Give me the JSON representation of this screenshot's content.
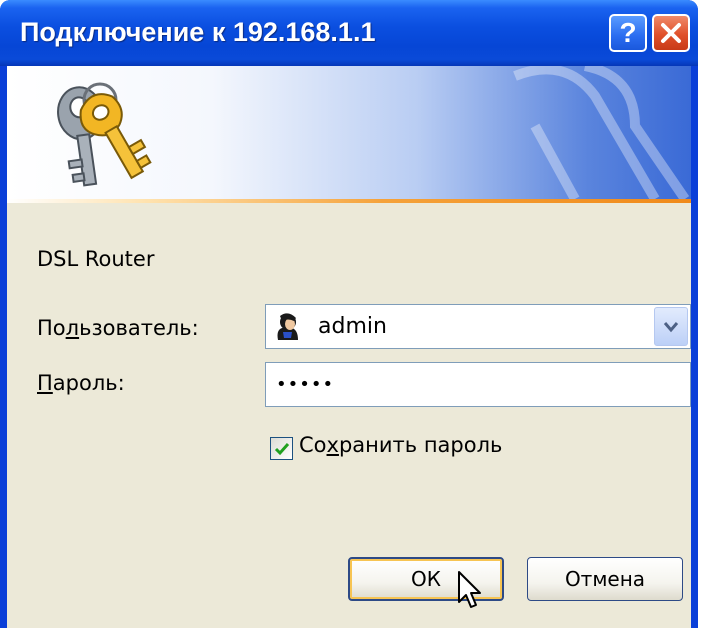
{
  "window": {
    "title": "Подключение к 192.168.1.1",
    "help_button": "?",
    "close_button": "✕"
  },
  "icons": {
    "banner": "keys-icon",
    "user": "user-icon",
    "dropdown": "chevron-down-icon",
    "checkbox": "checkmark-icon",
    "cursor": "mouse-pointer-icon"
  },
  "dialog": {
    "realm": "DSL Router",
    "username_label_prefix": "По",
    "username_label_underlined": "л",
    "username_label_suffix": "ьзователь:",
    "username_value": "admin",
    "password_label_underlined": "П",
    "password_label_suffix": "ароль:",
    "password_value": "•••••",
    "remember_label_prefix": "Со",
    "remember_label_underlined": "х",
    "remember_label_suffix": "ранить пароль",
    "remember_checked": true,
    "ok_label": "ОК",
    "cancel_label": "Отмена"
  },
  "colors": {
    "titlebar": "#0646d6",
    "face": "#ece9d8",
    "accent_line": "#f5a23a",
    "check": "#21a121"
  }
}
